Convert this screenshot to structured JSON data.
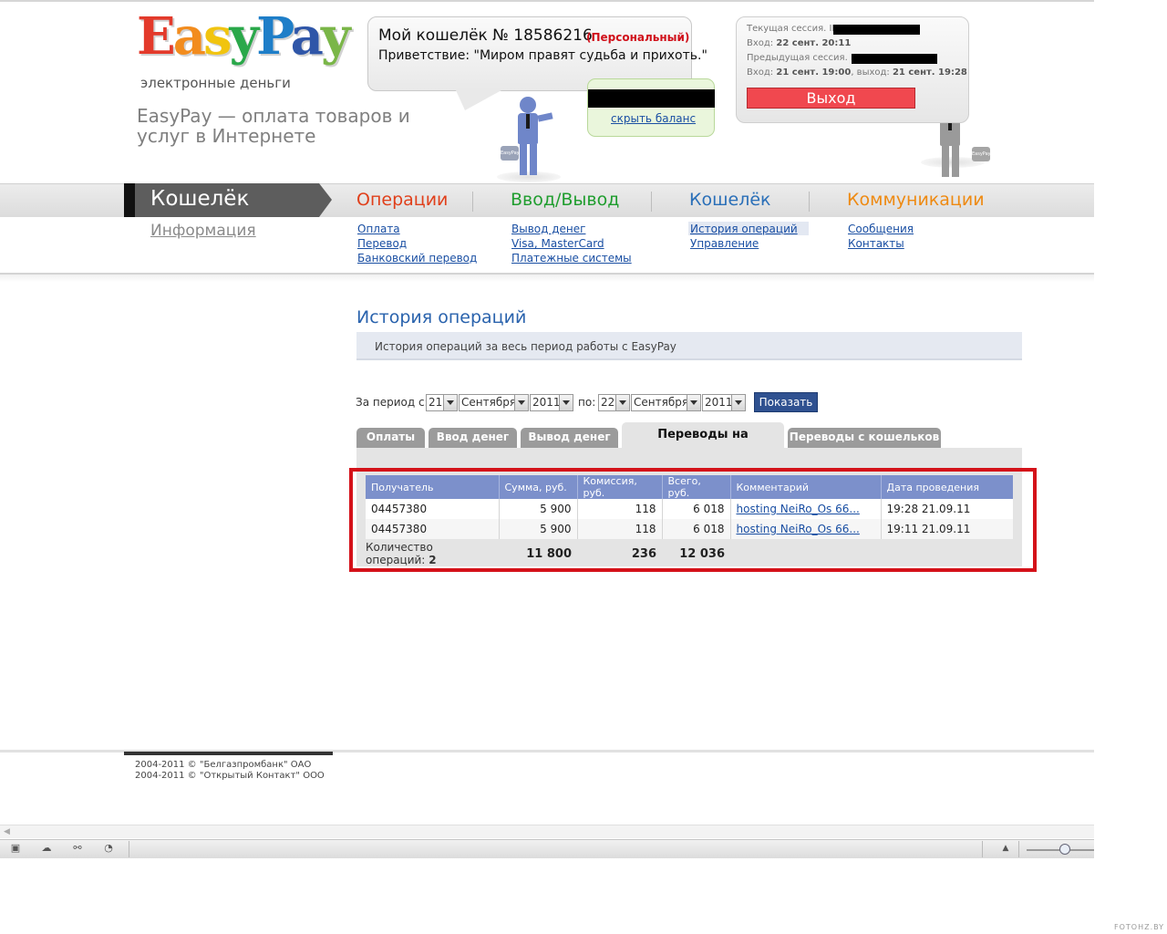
{
  "header": {
    "logo_letters": [
      "E",
      "a",
      "s",
      "y",
      "P",
      "a",
      "y"
    ],
    "logo_subtitle": "электронные деньги",
    "slogan": "EasyPay — оплата товаров и услуг в Интернете",
    "wallet_title": "Мой кошелёк № 18586216",
    "wallet_type": "(Персональный)",
    "greeting": "Приветствие: \"Миром правят судьба и прихоть.\"",
    "hide_balance": "скрыть баланс",
    "bag_label": "EasyPay",
    "session": {
      "current_ip_label": "Текущая сессия. IP:",
      "login_label": "Вход:",
      "login_time": "22 сент. 20:11",
      "prev_ip_label": "Предыдущая сессия. IP:",
      "prev_login_label": "Вход:",
      "prev_login_time": "21 сент. 19:00",
      "prev_logout_label": ", выход:",
      "prev_logout_time": "21 сент. 19:28",
      "logout_button": "Выход"
    }
  },
  "nav": {
    "active_section": "Кошелёк",
    "info_link": "Информация",
    "tabs": [
      {
        "label": "Операции",
        "color": "#e0401b",
        "items": [
          "Оплата",
          "Перевод",
          "Банковский перевод"
        ]
      },
      {
        "label": "Ввод/Вывод",
        "color": "#1f9d2e",
        "items": [
          "Вывод денег",
          "Visa, MasterCard",
          "Платежные системы"
        ]
      },
      {
        "label": "Кошелёк",
        "color": "#2a6fb8",
        "items": [
          "История операций",
          "Управление"
        ]
      },
      {
        "label": "Коммуникации",
        "color": "#ee8a12",
        "items": [
          "Сообщения",
          "Контакты"
        ]
      }
    ]
  },
  "content": {
    "title": "История операций",
    "info": "История операций за весь период работы с EasyPay",
    "period": {
      "from_label": "За период с:",
      "from_day": "21",
      "from_month": "Сентября",
      "from_year": "2011",
      "to_label": "по:",
      "to_day": "22",
      "to_month": "Сентября",
      "to_year": "2011",
      "show_button": "Показать"
    },
    "tabs": [
      "Оплаты",
      "Ввод денег",
      "Вывод денег",
      "Переводы на кошельки",
      "Переводы с кошельков"
    ],
    "active_tab": "Переводы на кошельки",
    "table": {
      "headers": [
        "Получатель",
        "Сумма, руб.",
        "Комиссия, руб.",
        "Всего, руб.",
        "Комментарий",
        "Дата проведения"
      ],
      "rows": [
        [
          "04457380",
          "5 900",
          "118",
          "6 018",
          "hosting NeiRo_Os 66...",
          "19:28 21.09.11"
        ],
        [
          "04457380",
          "5 900",
          "118",
          "6 018",
          "hosting NeiRo_Os 66...",
          "19:11 21.09.11"
        ]
      ],
      "totals": {
        "label": "Количество операций:",
        "count": "2",
        "sum": "11 800",
        "commission": "236",
        "total": "12 036"
      }
    }
  },
  "footer": {
    "lines": [
      "2004-2011 © \"Белгазпромбанк\" ОАО",
      "2004-2011 © \"Открытый Контакт\" ООО"
    ]
  },
  "watermark": "FOTOHZ.BY"
}
